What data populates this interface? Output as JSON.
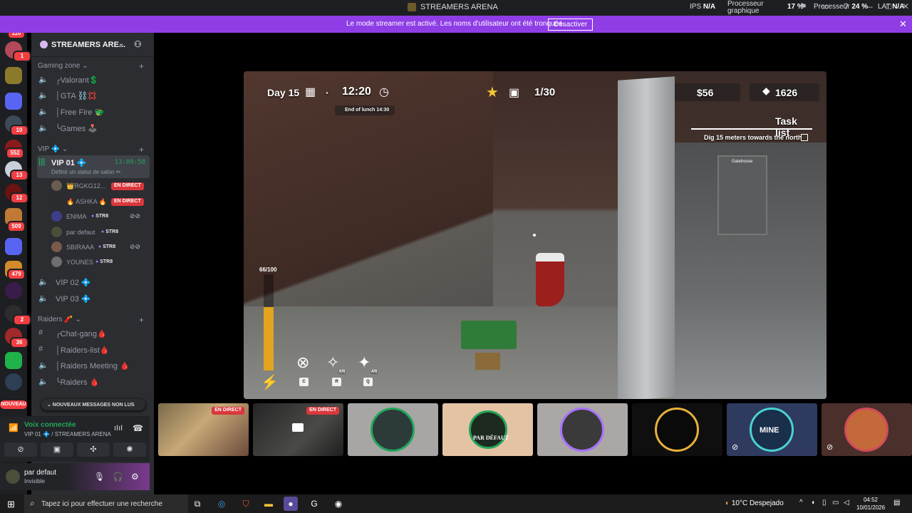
{
  "window": {
    "title": "STREAMERS ARENA",
    "stats": {
      "ips_label": "IPS",
      "ips_value": "N/A",
      "gpu_label_1": "Processeur",
      "gpu_label_2": "graphique",
      "gpu_value": "17",
      "cpu_label": "Processeur",
      "cpu_value": "24",
      "lat_label": "LAT",
      "lat_value": "N/A",
      "pct": "%"
    }
  },
  "banner": {
    "text": "Le mode streamer est activé. Les noms d'utilisateur ont été tronqués.",
    "button": "Désactiver"
  },
  "rail": {
    "badges": [
      "110",
      "1",
      "10",
      "552",
      "13",
      "12",
      "509",
      "479",
      "2",
      "36"
    ],
    "nouveau": "NOUVEAU"
  },
  "server": {
    "name": "STREAMERS ARE...",
    "chevron": "⌄"
  },
  "categories": {
    "gaming": "Gaming zone ⌄",
    "vip": "VIP 💠 ⌄",
    "raiders": "Raiders 🧨 ⌄",
    "plus": "+"
  },
  "gaming_channels": [
    "╭Valorant💲",
    "│GTA ⛓️💢",
    "│Free Fire 🐲",
    "╰Games 🕹️"
  ],
  "vip_channel": {
    "name": "VIP 01 💠",
    "time": "13:09:58",
    "status": "Définir un statut de salon ✏"
  },
  "vip_users": [
    {
      "name": "👑RGKG12...",
      "tag": "EN DIRECT"
    },
    {
      "name": "🔥 ASHKA 🔥",
      "tag": "EN DIRECT"
    },
    {
      "name": "ENIMA",
      "tag": "STR8"
    },
    {
      "name": "par defaut",
      "tag": "STR8"
    },
    {
      "name": "SBIRAAA",
      "tag": "STR8"
    },
    {
      "name": "YOUNES",
      "tag": "STR8"
    }
  ],
  "vip_other": [
    "VIP 02 💠",
    "VIP 03 💠"
  ],
  "raiders_channels": [
    "╭Chat-gang🩸",
    "│Raiders-list🩸",
    "│Raiders Meeting 🩸",
    "╰Raiders 🩸"
  ],
  "new_messages": "⌄ NOUVEAUX MESSAGES NON LUS",
  "voice": {
    "connected": "Voix connectée",
    "channel": "VIP 01 💠 / STREAMERS ARENA"
  },
  "user": {
    "name": "par defaut",
    "status": "Invisible"
  },
  "game_hud": {
    "day": "Day 15",
    "time": "12:20",
    "time_note": "End of lunch 14:30",
    "count": "1/30",
    "money": "$56",
    "gems": "1626",
    "task_title": "Task list",
    "task_item": "Dig 15 meters towards the north",
    "stamina": "66/100",
    "stamina_fraction": 0.66,
    "tool_counts": [
      "6/6",
      "4/6"
    ],
    "keys": [
      "C",
      "R",
      "Q"
    ],
    "sign": "Gatehouse"
  },
  "thumbnails": [
    {
      "live": "EN DIRECT"
    },
    {
      "live": "EN DIRECT"
    },
    {
      "label": ""
    },
    {
      "label": "PAR DÉFAUT"
    },
    {
      "label": ""
    },
    {
      "label": ""
    },
    {
      "label": "MINE"
    },
    {
      "label": ""
    }
  ],
  "taskbar": {
    "search_placeholder": "Tapez ici pour effectuer une recherche",
    "weather": "10°C  Despejado",
    "time": "04:52",
    "date": "10/01/2026"
  },
  "colors": {
    "accent": "#8f3ee6",
    "live_red": "#da373c",
    "voice_green": "#23a55a",
    "sidebar": "#2b2d31"
  }
}
